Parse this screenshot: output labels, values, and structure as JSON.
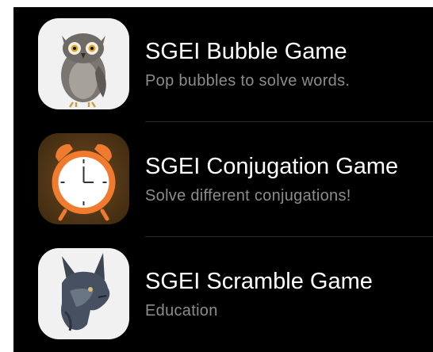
{
  "apps": [
    {
      "title": "SGEI Bubble Game",
      "subtitle": "Pop bubbles to solve words.",
      "icon": "owl-icon"
    },
    {
      "title": "SGEI Conjugation Game",
      "subtitle": "Solve different conjugations!",
      "icon": "alarm-clock-icon"
    },
    {
      "title": "SGEI Scramble Game",
      "subtitle": "Education",
      "icon": "lynx-icon"
    }
  ],
  "colors": {
    "background": "#000000",
    "title": "#ffffff",
    "subtitle": "#8c8c8e"
  }
}
